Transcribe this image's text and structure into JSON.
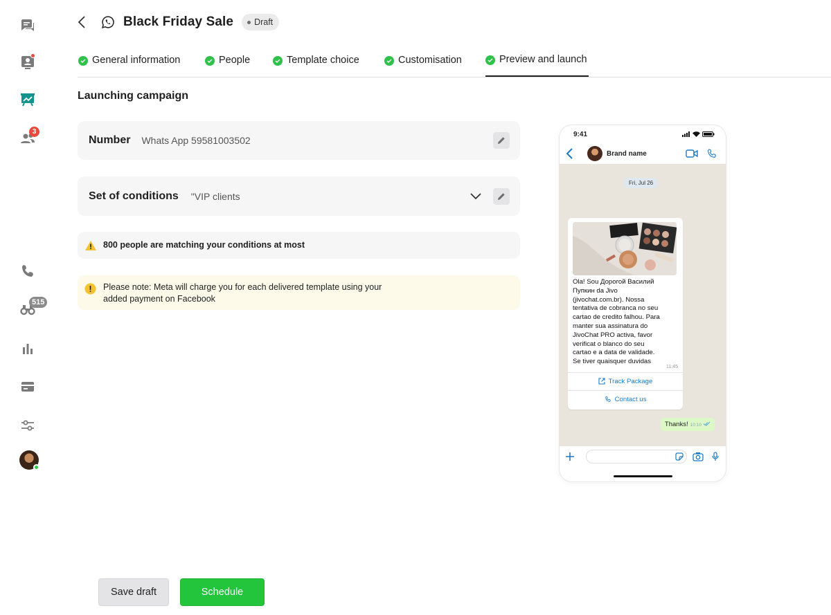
{
  "sidebar": {
    "items": [
      {
        "name": "chats",
        "icon": "chat-bubbles-icon"
      },
      {
        "name": "visitors",
        "icon": "contact-card-icon"
      },
      {
        "name": "campaigns",
        "icon": "presentation-chart-icon"
      },
      {
        "name": "team",
        "icon": "people-icon",
        "badge": "3"
      },
      {
        "name": "calls",
        "icon": "phone-icon"
      },
      {
        "name": "monitoring",
        "icon": "binoculars-icon",
        "badge": "515"
      },
      {
        "name": "reports",
        "icon": "bar-chart-icon"
      },
      {
        "name": "billing",
        "icon": "credit-card-icon"
      },
      {
        "name": "settings",
        "icon": "sliders-icon"
      }
    ],
    "accent": "#12948c"
  },
  "header": {
    "title": "Black Friday Sale",
    "status": "Draft"
  },
  "tabs": [
    {
      "label": "General information"
    },
    {
      "label": "People"
    },
    {
      "label": "Template choice"
    },
    {
      "label": "Customisation"
    },
    {
      "label": "Preview and launch",
      "active": true
    }
  ],
  "main": {
    "section_title": "Launching campaign",
    "number_label": "Number",
    "number_value": "Whats App 59581003502",
    "conditions_label": "Set of conditions",
    "conditions_value": "\"VIP clients",
    "warning_text": "800 people are matching your conditions at most",
    "note_line1": "Please note: Meta will charge you for each delivered template using your",
    "note_line2": "added payment on Facebook"
  },
  "actions": {
    "save_label": "Save draft",
    "schedule_label": "Schedule"
  },
  "phone": {
    "time": "9:41",
    "contact_name": "Brand name",
    "date": "Fri, Jul 26",
    "message_lines": [
      "Ola! Sou Дорогой Василий",
      "Пупкин da Jivo",
      "(jivochat.com.br). Nossa",
      "tentativa de cobranca no seu",
      "cartao de credito falhou. Para",
      "manter sua assinatura do",
      "JivoChat PRO activa, favor",
      "verificat o blanco do seu",
      "cartao e a data de validade.",
      "Se tiver quaisquer duvidas"
    ],
    "message_time": "11:45",
    "button1": "Track Package",
    "button2": "Contact us",
    "reply": "Thanks!",
    "reply_time": "10:10"
  },
  "colors": {
    "success": "#2fc14a",
    "primary_button": "#22c53c",
    "warning_bg": "#fdfaea",
    "link": "#1a7ac9"
  }
}
